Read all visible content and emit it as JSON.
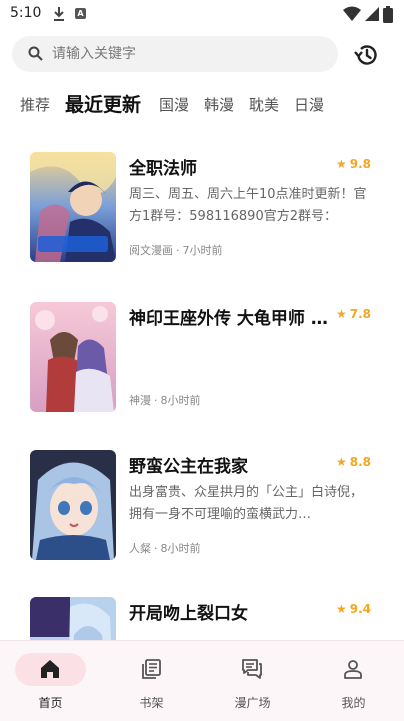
{
  "status_bar": {
    "time": "5:10",
    "a_badge": "A"
  },
  "search": {
    "placeholder": "请输入关键字",
    "value": ""
  },
  "tabs": [
    {
      "label": "推荐",
      "active": false
    },
    {
      "label": "最近更新",
      "active": true
    },
    {
      "label": "国漫",
      "active": false
    },
    {
      "label": "韩漫",
      "active": false
    },
    {
      "label": "耽美",
      "active": false
    },
    {
      "label": "日漫",
      "active": false
    }
  ],
  "comics": [
    {
      "title": "全职法师",
      "rating": "9.8",
      "desc": "周三、周五、周六上午10点准时更新！官方1群号：598116890官方2群号：",
      "source": "阅文漫画",
      "time": "7小时前"
    },
    {
      "title": "神印王座外传 大龟甲师 …",
      "rating": "7.8",
      "desc": "",
      "source": "神漫",
      "time": "8小时前"
    },
    {
      "title": "野蛮公主在我家",
      "rating": "8.8",
      "desc": "出身富贵、众星拱月的「公主」白诗倪，拥有一身不可理喻的蛮横武力…",
      "source": "人粲",
      "time": "8小时前"
    },
    {
      "title": "开局吻上裂口女",
      "rating": "9.4",
      "desc": "",
      "source": "",
      "time": ""
    }
  ],
  "bottom_nav": [
    {
      "label": "首页",
      "icon": "home-icon",
      "active": true
    },
    {
      "label": "书架",
      "icon": "bookshelf-icon",
      "active": false
    },
    {
      "label": "漫广场",
      "icon": "chat-icon",
      "active": false
    },
    {
      "label": "我的",
      "icon": "person-icon",
      "active": false
    }
  ],
  "colors": {
    "rating": "#f5a623",
    "nav_active_pill": "#fbe1e5",
    "nav_bg": "#fdf6f8",
    "search_bg": "#f2f2f2"
  }
}
